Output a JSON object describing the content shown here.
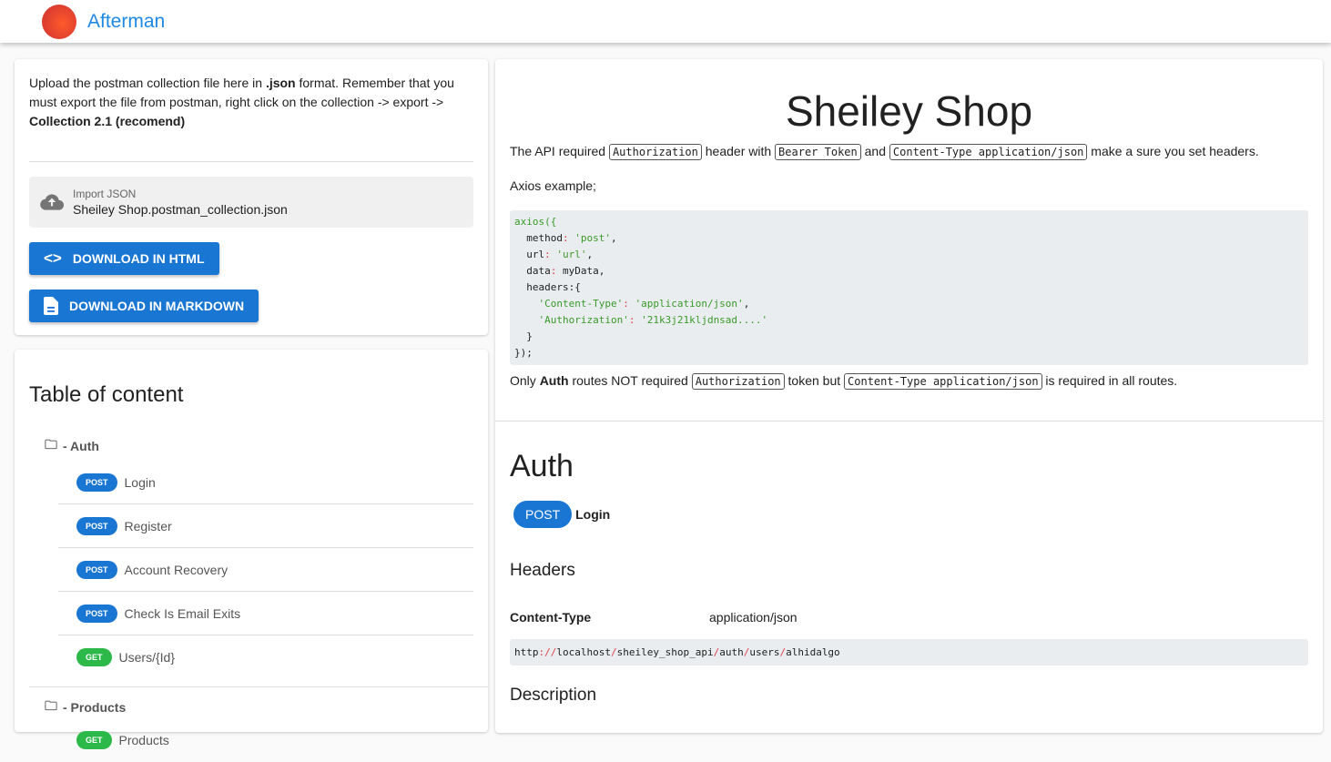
{
  "app": {
    "title": "Afterman"
  },
  "upload": {
    "intro_1": "Upload the postman collection file here in ",
    "intro_json": ".json",
    "intro_2": " format. Remember that you must export the file from postman, right click on the collection -> export -> ",
    "intro_bold": "Collection 2.1 (recomend)",
    "import_label": "Import JSON",
    "import_value": "Sheiley Shop.postman_collection.json",
    "btn_html": "DOWNLOAD IN HTML",
    "btn_md": "DOWNLOAD IN MARKDOWN"
  },
  "toc": {
    "title": "Table of content",
    "folders": [
      {
        "name": "- Auth",
        "items": [
          {
            "method": "POST",
            "name": "Login"
          },
          {
            "method": "POST",
            "name": "Register"
          },
          {
            "method": "POST",
            "name": "Account Recovery"
          },
          {
            "method": "POST",
            "name": "Check Is Email Exits"
          },
          {
            "method": "GET",
            "name": "Users/{Id}"
          }
        ]
      },
      {
        "name": "- Products",
        "items": [
          {
            "method": "GET",
            "name": "Products"
          }
        ]
      }
    ]
  },
  "doc": {
    "title": "Sheiley Shop",
    "p1_a": "The API required ",
    "p1_code1": "Authorization",
    "p1_b": " header with ",
    "p1_code2": "Bearer Token",
    "p1_c": " and ",
    "p1_code3": "Content-Type application/json",
    "p1_d": " make a sure you set headers.",
    "axios_label": "Axios example;",
    "code": {
      "l1": "axios({",
      "l2k": "  method",
      "l2v": "'post'",
      "l3k": "  url",
      "l3v": "'url'",
      "l4k": "  data",
      "l4v": " myData,",
      "l5": "  headers:{",
      "l6k": "    'Content-Type'",
      "l6v": "'application/json'",
      "l7k": "    'Authorization'",
      "l7v": "'21k3j21kljdnsad....'",
      "l8": "  }",
      "l9": "});"
    },
    "p2_a": "Only ",
    "p2_bold": "Auth",
    "p2_b": " routes NOT required ",
    "p2_code1": "Authorization",
    "p2_c": " token but ",
    "p2_code2": "Content-Type application/json",
    "p2_d": " is required in all routes.",
    "section": "Auth",
    "endpoint": {
      "method": "POST",
      "name": "Login"
    },
    "headers_title": "Headers",
    "header_key": "Content-Type",
    "header_value": "application/json",
    "url": {
      "scheme": "http",
      "sep1": "://",
      "host": "localhost",
      "p1": "sheiley_shop_api",
      "p2": "auth",
      "p3": "users",
      "p4": "alhidalgo",
      "slash": "/"
    },
    "description_title": "Description"
  }
}
